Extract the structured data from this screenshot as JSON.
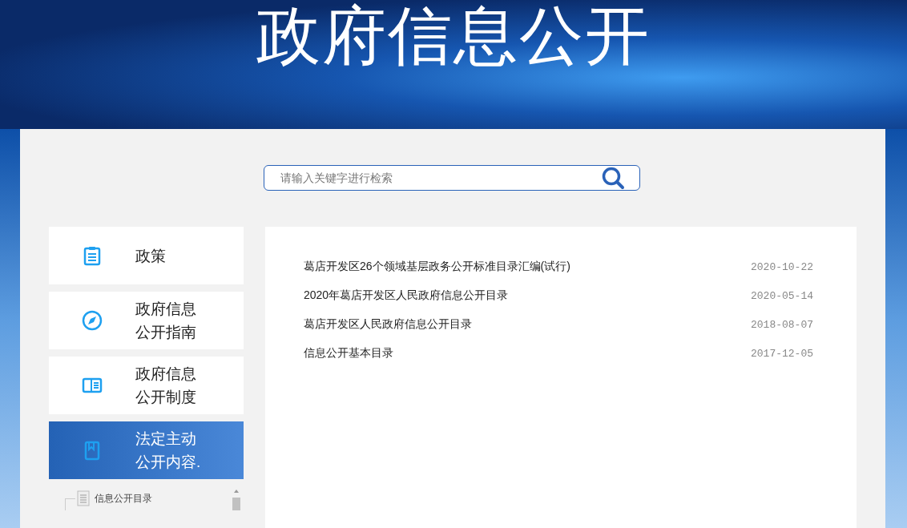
{
  "header": {
    "title": "政府信息公开"
  },
  "search": {
    "placeholder": "请输入关键字进行检索"
  },
  "sidebar": {
    "items": [
      {
        "label": "政策",
        "selected": false
      },
      {
        "label": "政府信息公开指南",
        "selected": false
      },
      {
        "label": "政府信息公开制度",
        "selected": false
      },
      {
        "label": "法定主动公开内容.",
        "selected": true
      }
    ],
    "tree": [
      {
        "label": "信息公开目录"
      }
    ]
  },
  "list": [
    {
      "title": "葛店开发区26个领域基层政务公开标准目录汇编(试行)",
      "date": "2020-10-22"
    },
    {
      "title": "2020年葛店开发区人民政府信息公开目录",
      "date": "2020-05-14"
    },
    {
      "title": "葛店开发区人民政府信息公开目录",
      "date": "2018-08-07"
    },
    {
      "title": "信息公开基本目录",
      "date": "2017-12-05"
    }
  ]
}
